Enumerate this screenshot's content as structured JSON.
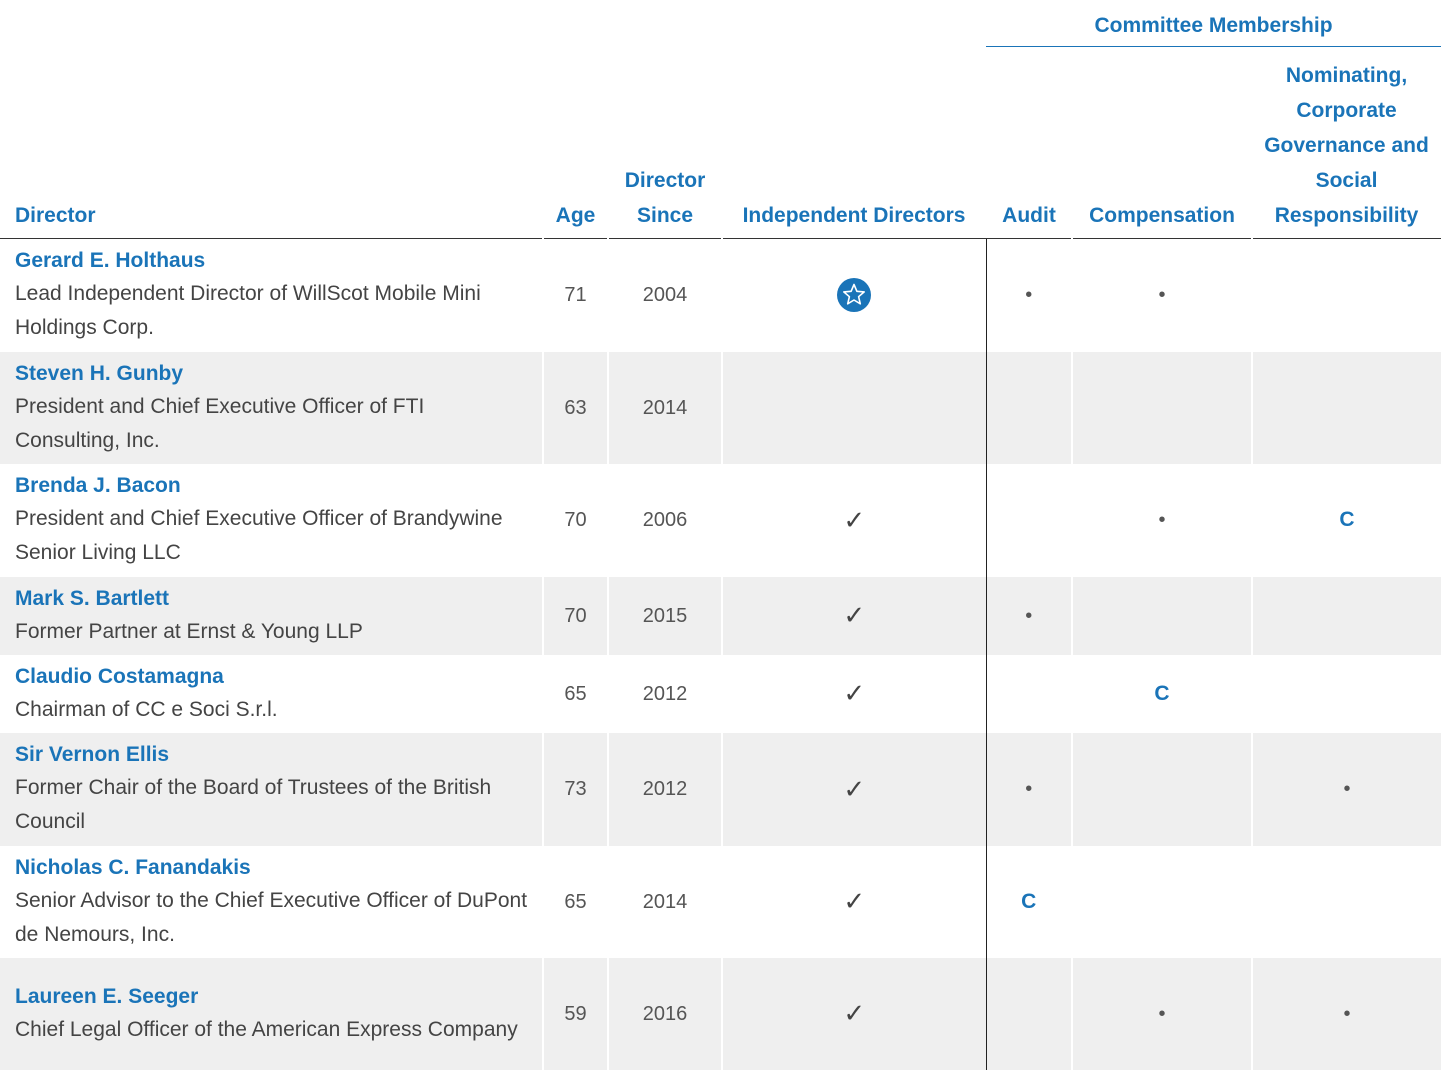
{
  "header": {
    "committee_membership": "Committee Membership",
    "director": "Director",
    "age": "Age",
    "director_since": "Director Since",
    "independent_directors": "Independent Directors",
    "audit": "Audit",
    "compensation": "Compensation",
    "nominating": "Nominating, Corporate Governance and Social Responsibility"
  },
  "rows": [
    {
      "name": "Gerard E. Holthaus",
      "title": "Lead Independent Director of WillScot Mobile Mini Holdings Corp.",
      "age": "71",
      "since": "2004",
      "independent": "star-icon",
      "audit": "•",
      "compensation": "•",
      "nominating": ""
    },
    {
      "name": "Steven H. Gunby",
      "title": "President and Chief Executive Officer of FTI Consulting, Inc.",
      "age": "63",
      "since": "2014",
      "independent": "",
      "audit": "",
      "compensation": "",
      "nominating": ""
    },
    {
      "name": "Brenda J. Bacon",
      "title": "President and Chief Executive Officer of Brandywine Senior Living LLC",
      "age": "70",
      "since": "2006",
      "independent": "✓",
      "audit": "",
      "compensation": "•",
      "nominating": "C"
    },
    {
      "name": "Mark S. Bartlett",
      "title": "Former Partner at Ernst & Young LLP",
      "age": "70",
      "since": "2015",
      "independent": "✓",
      "audit": "•",
      "compensation": "",
      "nominating": ""
    },
    {
      "name": "Claudio Costamagna",
      "title": "Chairman of CC e Soci S.r.l.",
      "age": "65",
      "since": "2012",
      "independent": "✓",
      "audit": "",
      "compensation": "C",
      "nominating": ""
    },
    {
      "name": "Sir Vernon Ellis",
      "title": "Former Chair of the Board of Trustees of the British Council",
      "age": "73",
      "since": "2012",
      "independent": "✓",
      "audit": "•",
      "compensation": "",
      "nominating": "•"
    },
    {
      "name": "Nicholas C. Fanandakis",
      "title": "Senior Advisor to the Chief Executive Officer of DuPont de Nemours, Inc.",
      "age": "65",
      "since": "2014",
      "independent": "✓",
      "audit": "C",
      "compensation": "",
      "nominating": ""
    },
    {
      "name": "Laureen E. Seeger",
      "title": "Chief Legal Officer of the American Express Company",
      "age": "59",
      "since": "2016",
      "independent": "✓",
      "audit": "",
      "compensation": "•",
      "nominating": "•"
    }
  ],
  "colors": {
    "accent": "#1a74b8",
    "row_alt": "#efefef",
    "text": "#444444"
  }
}
